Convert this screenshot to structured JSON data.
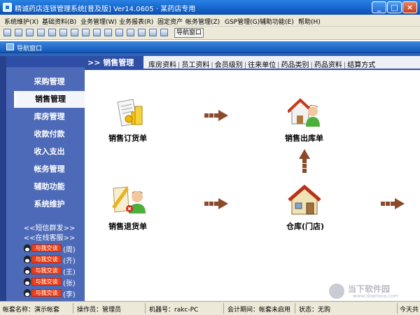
{
  "window": {
    "title": "精诚药店连锁管理系统[普及版] Ver14.0605 · 某药店专用",
    "controls": [
      "_",
      "□",
      "×"
    ]
  },
  "menu": [
    "系统维护(X)",
    "基础资料(B)",
    "业务管理(W)",
    "业务报表(R)",
    "固定资产",
    "帐务管理(Z)",
    "GSP管理(G)",
    "辅助功能(E)",
    "帮助(H)"
  ],
  "toolbar": {
    "nav_button": "导航窗口"
  },
  "nav_window": {
    "title": "导航窗口"
  },
  "sidebar": {
    "items": [
      "采购管理",
      "销售管理",
      "库房管理",
      "收款付款",
      "收入支出",
      "帐务管理",
      "辅助功能",
      "系统维护"
    ],
    "active_index": 1,
    "links": [
      "<<短信群发>>",
      "<<在线客服>>"
    ],
    "qq_badge": "与我交谈",
    "qq_contacts": [
      "(周)",
      "(齐)",
      "(王)",
      "(张)",
      "(李)"
    ]
  },
  "tabbar": {
    "current": ">> 销售管理",
    "links": [
      "库房资料",
      "员工资料",
      "会员级别",
      "往来单位",
      "药品类别",
      "药品资料",
      "结算方式"
    ],
    "separator": "|"
  },
  "workflow": {
    "sales_order": "销售订货单",
    "sales_outbound": "销售出库单",
    "sales_return": "销售退货单",
    "warehouse": "仓库(门店)"
  },
  "status": {
    "account": "帐套名称：演示帐套",
    "operator": "操作员：管理员",
    "machine": "机器号：rakc-PC",
    "period": "会计期间：帐套未启用",
    "state": "状态：无购",
    "today": "今天共"
  },
  "watermark": {
    "main": "当下软件园",
    "sub": "www.downxia.com"
  },
  "colors": {
    "sidebar": "#4d6ab8",
    "active_item": "#f3f5fb",
    "arrow": "#8b4a2a",
    "titlebar": "#1563c9"
  }
}
